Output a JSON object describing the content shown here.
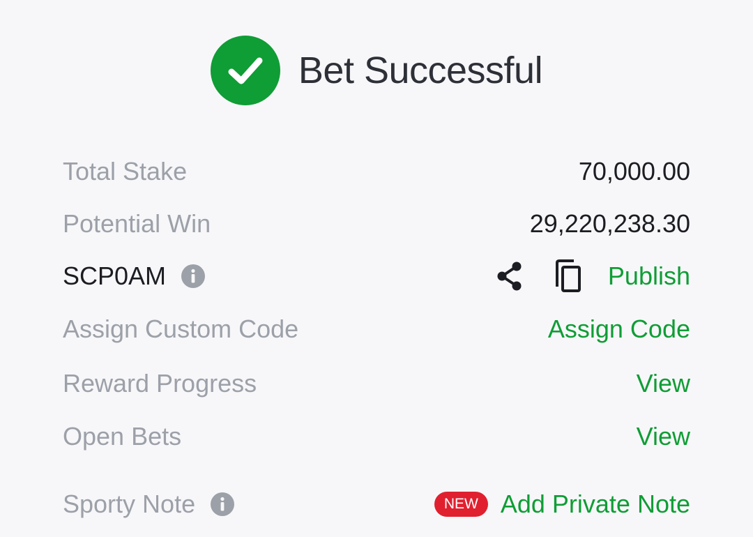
{
  "header": {
    "title": "Bet Successful"
  },
  "rows": {
    "total_stake": {
      "label": "Total Stake",
      "value": "70,000.00"
    },
    "potential_win": {
      "label": "Potential Win",
      "value": "29,220,238.30"
    },
    "booking": {
      "code": "SCP0AM",
      "publish_label": "Publish"
    },
    "custom_code": {
      "label": "Assign Custom Code",
      "action_label": "Assign Code"
    },
    "reward_progress": {
      "label": "Reward Progress",
      "action_label": "View"
    },
    "open_bets": {
      "label": "Open Bets",
      "action_label": "View"
    },
    "sporty_note": {
      "label": "Sporty Note",
      "badge": "NEW",
      "action_label": "Add Private Note"
    }
  },
  "icons": {
    "success": "check-circle-icon",
    "info": "info-icon",
    "share": "share-icon",
    "copy": "copy-icon"
  },
  "colors": {
    "accent_green": "#0f9d35",
    "badge_red": "#e0202f",
    "muted_text": "#9ca0a8",
    "dark_text": "#1b1d22",
    "background": "#f7f7f9"
  }
}
